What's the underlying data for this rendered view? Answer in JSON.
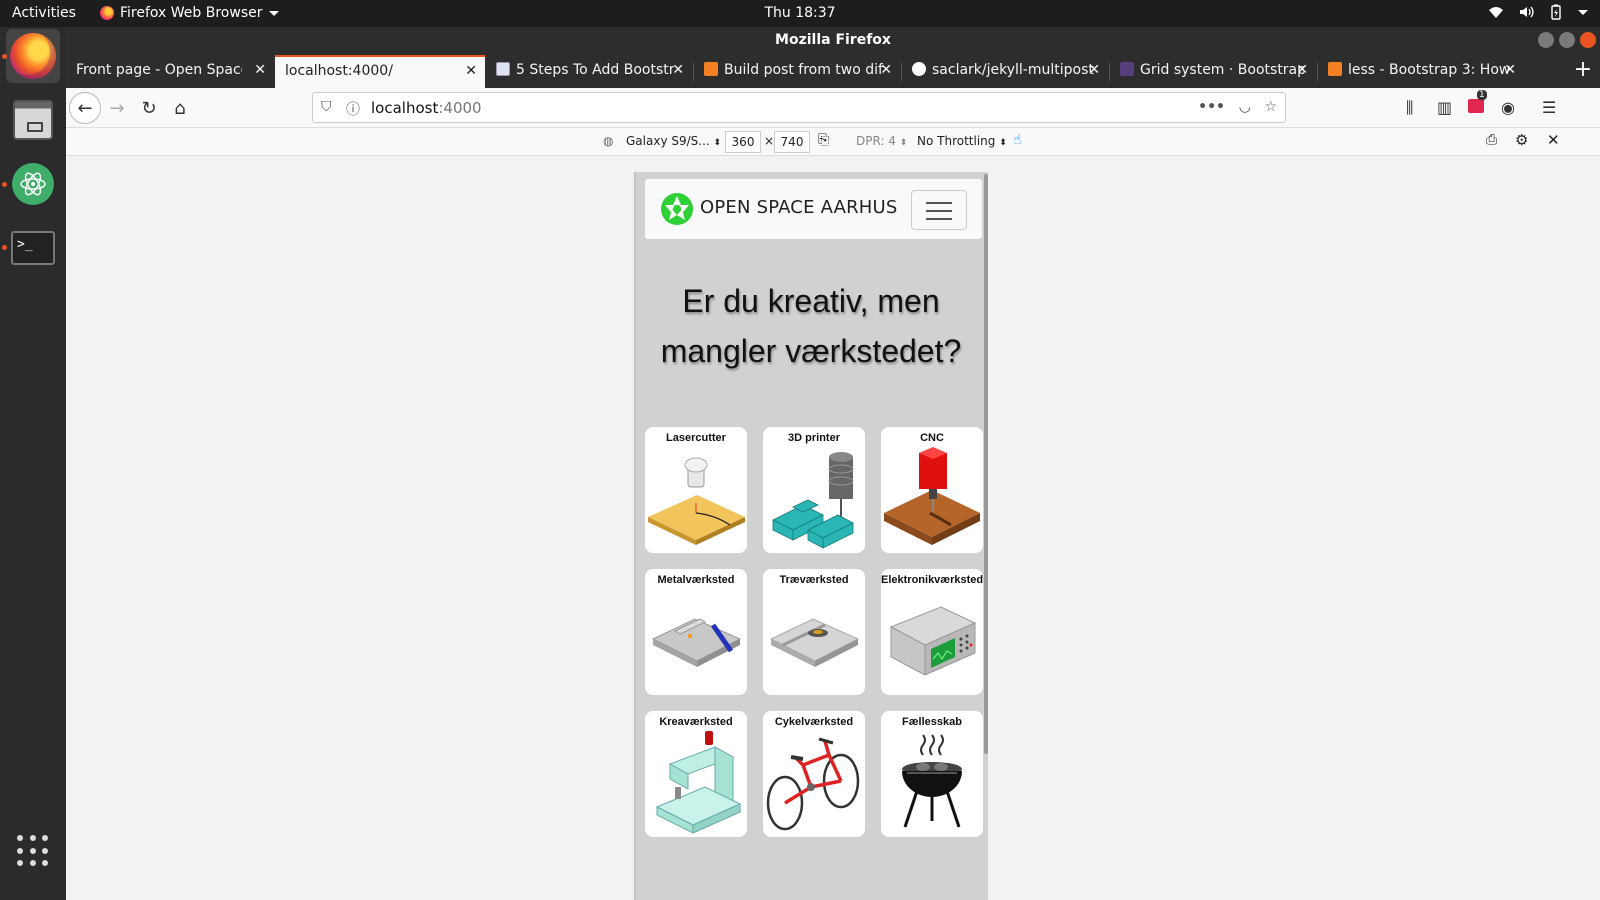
{
  "topbar": {
    "activities": "Activities",
    "app_name": "Firefox Web Browser",
    "clock": "Thu 18:37"
  },
  "window": {
    "title": "Mozilla Firefox"
  },
  "tabs": [
    {
      "label": "Front page - Open Space A",
      "selected": false
    },
    {
      "label": "localhost:4000/",
      "selected": true
    },
    {
      "label": "5 Steps To Add Bootstr",
      "selected": false
    },
    {
      "label": "Build post from two dif",
      "selected": false
    },
    {
      "label": "saclark/jekyll-multipost",
      "selected": false
    },
    {
      "label": "Grid system · Bootstrap",
      "selected": false
    },
    {
      "label": "less - Bootstrap 3: How",
      "selected": false
    }
  ],
  "urlbar": {
    "host": "localhost",
    "port": ":4000"
  },
  "rdm": {
    "device": "Galaxy S9/S...",
    "width": "360",
    "times": "×",
    "height": "740",
    "dpr": "DPR: 4",
    "throttling": "No Throttling",
    "notification_badge": "1"
  },
  "site": {
    "brand": "OPEN SPACE AARHUS",
    "hero_line1": "Er du kreativ, men",
    "hero_line2": "mangler værkstedet?",
    "workshops": [
      {
        "label": "Lasercutter",
        "icon": "lasercutter"
      },
      {
        "label": "3D printer",
        "icon": "3d-printer"
      },
      {
        "label": "CNC",
        "icon": "cnc"
      },
      {
        "label": "Metalværksted",
        "icon": "metal-workshop"
      },
      {
        "label": "Træværksted",
        "icon": "wood-workshop"
      },
      {
        "label": "Elektronikværksted",
        "icon": "electronics-workshop"
      },
      {
        "label": "Kreaværksted",
        "icon": "sewing-machine"
      },
      {
        "label": "Cykelværksted",
        "icon": "bicycle"
      },
      {
        "label": "Fællesskab",
        "icon": "grill"
      }
    ]
  },
  "colors": {
    "accent": "#e95420",
    "page_bg": "#d1d1d1",
    "logo_green": "#2fcf36"
  }
}
